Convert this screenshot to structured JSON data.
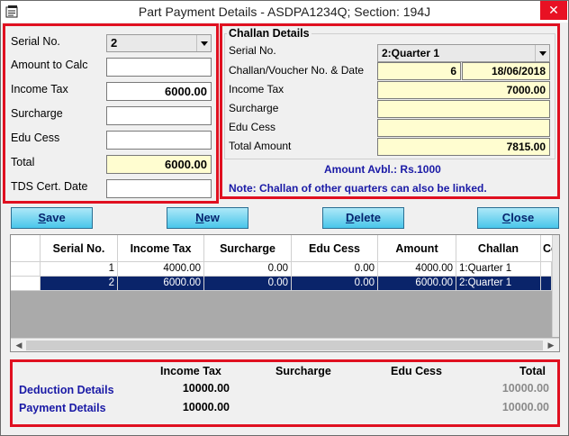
{
  "window": {
    "title": "Part Payment Details - ASDPA1234Q; Section: 194J",
    "close_glyph": "✕"
  },
  "left_form": {
    "serial_label": "Serial No.",
    "serial_value": "2",
    "amount_calc_label": "Amount to Calc",
    "amount_calc_value": "",
    "income_tax_label": "Income Tax",
    "income_tax_value": "6000.00",
    "surcharge_label": "Surcharge",
    "surcharge_value": "",
    "edu_cess_label": "Edu Cess",
    "edu_cess_value": "",
    "total_label": "Total",
    "total_value": "6000.00",
    "tds_date_label": "TDS Cert. Date",
    "tds_date_value": ""
  },
  "challan": {
    "group_title": "Challan Details",
    "serial_label": "Serial No.",
    "serial_value": "2:Quarter 1",
    "voucher_label": "Challan/Voucher No. & Date",
    "voucher_no": "6",
    "voucher_date": "18/06/2018",
    "income_tax_label": "Income Tax",
    "income_tax_value": "7000.00",
    "surcharge_label": "Surcharge",
    "surcharge_value": "",
    "edu_cess_label": "Edu Cess",
    "edu_cess_value": "",
    "total_label": "Total Amount",
    "total_value": "7815.00",
    "amount_avbl": "Amount Avbl.: Rs.1000",
    "note": "Note: Challan of other quarters can also be linked."
  },
  "buttons": {
    "save_ul": "S",
    "save_rest": "ave",
    "new_ul": "N",
    "new_rest": "ew",
    "delete_ul": "D",
    "delete_rest": "elete",
    "close_ul": "C",
    "close_rest": "lose"
  },
  "grid": {
    "columns": [
      "Serial No.",
      "Income Tax",
      "Surcharge",
      "Edu Cess",
      "Amount",
      "Challan",
      "Ce"
    ],
    "rows": [
      [
        "1",
        "4000.00",
        "0.00",
        "0.00",
        "4000.00",
        "1:Quarter 1",
        ""
      ],
      [
        "2",
        "6000.00",
        "0.00",
        "0.00",
        "6000.00",
        "2:Quarter 1",
        ""
      ]
    ],
    "selected_row": 1
  },
  "summary": {
    "col_income_tax": "Income Tax",
    "col_surcharge": "Surcharge",
    "col_edu_cess": "Edu Cess",
    "col_total": "Total",
    "deduction_label": "Deduction Details",
    "deduction_income_tax": "10000.00",
    "deduction_total": "10000.00",
    "payment_label": "Payment Details",
    "payment_income_tax": "10000.00",
    "payment_total": "10000.00"
  },
  "colors": {
    "highlight_red": "#e01020",
    "label_blue": "#1a1aa6",
    "selection_navy": "#0a246a",
    "input_yellow": "#fffdd0"
  }
}
